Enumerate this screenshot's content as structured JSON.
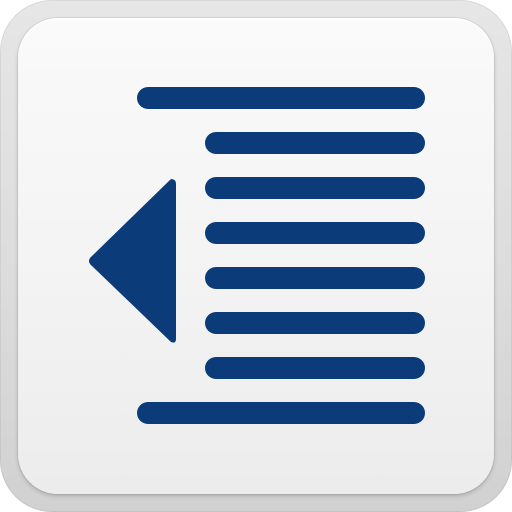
{
  "icon": {
    "name": "outdent-icon",
    "glyph_color": "#0b3b78",
    "frame_color": "#dcdcdc",
    "face_color": "#f5f5f5",
    "arrow_direction": "left",
    "full_width_lines": 2,
    "indented_lines": 6
  }
}
